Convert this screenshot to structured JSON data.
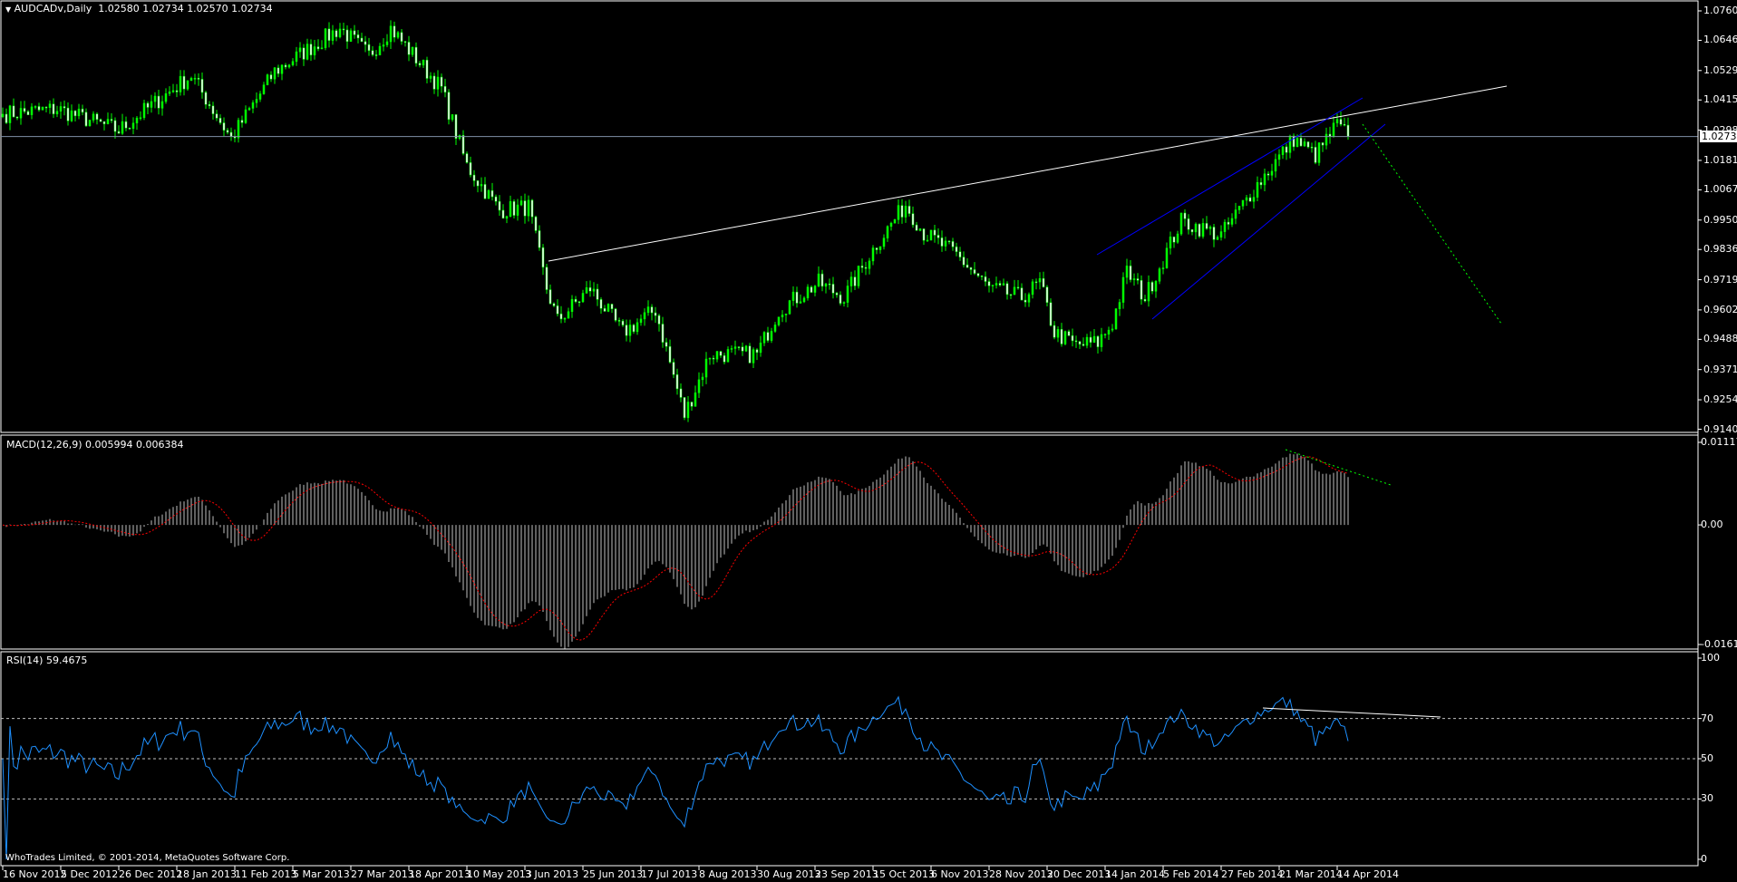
{
  "header": {
    "symbol_title": "AUDCADv,Daily",
    "ohlc": "1.02580 1.02734 1.02570 1.02734"
  },
  "macd_title": "MACD(12,26,9) 0.005994 0.006384",
  "rsi_title": "RSI(14) 59.4675",
  "copyright": "WhoTrades Limited, © 2001-2014, MetaQuotes Software Corp.",
  "colors": {
    "candle": "#00ff00",
    "macd_hist": "#c0c0c0",
    "macd_signal": "#ff0000",
    "rsi": "#1e90ff",
    "trendline": "#ffffff",
    "channel": "#0000ff",
    "projection": "#00ff00",
    "price_line": "#8090a8"
  },
  "chart_data": [
    {
      "type": "candlestick",
      "title": "AUDCADv,Daily",
      "current_price": "1.02734",
      "y_ticks": [
        "1.07600",
        "1.06460",
        "1.05290",
        "1.04150",
        "1.02980",
        "1.01810",
        "1.00670",
        "0.99500",
        "0.98360",
        "0.97190",
        "0.96020",
        "0.94880",
        "0.93710",
        "0.92540",
        "0.91400"
      ],
      "ylim": [
        0.914,
        1.076
      ],
      "x_ticks": [
        "16 Nov 2012",
        "5 Dec 2012",
        "26 Dec 2012",
        "18 Jan 2013",
        "11 Feb 2013",
        "5 Mar 2013",
        "27 Mar 2013",
        "18 Apr 2013",
        "10 May 2013",
        "3 Jun 2013",
        "25 Jun 2013",
        "17 Jul 2013",
        "8 Aug 2013",
        "30 Aug 2013",
        "23 Sep 2013",
        "15 Oct 2013",
        "6 Nov 2013",
        "28 Nov 2013",
        "20 Dec 2013",
        "14 Jan 2014",
        "5 Feb 2014",
        "27 Feb 2014",
        "21 Mar 2014",
        "14 Apr 2014"
      ],
      "bars_per_tick": 16,
      "bar_count": 372,
      "close_anchors": [
        [
          0,
          1.036
        ],
        [
          15,
          1.038
        ],
        [
          32,
          1.0297
        ],
        [
          52,
          1.051
        ],
        [
          63,
          1.0265
        ],
        [
          75,
          1.0525
        ],
        [
          93,
          1.0693
        ],
        [
          101,
          1.0588
        ],
        [
          107,
          1.0693
        ],
        [
          121,
          1.0458
        ],
        [
          128,
          1.016
        ],
        [
          137,
          0.9988
        ],
        [
          145,
          1.0
        ],
        [
          150,
          0.9686
        ],
        [
          153,
          0.956
        ],
        [
          162,
          0.9686
        ],
        [
          171,
          0.9514
        ],
        [
          180,
          0.9602
        ],
        [
          188,
          0.9194
        ],
        [
          195,
          0.943
        ],
        [
          208,
          0.943
        ],
        [
          214,
          0.9602
        ],
        [
          225,
          0.9707
        ],
        [
          232,
          0.965
        ],
        [
          241,
          0.9858
        ],
        [
          249,
          1.001
        ],
        [
          254,
          0.99
        ],
        [
          263,
          0.9816
        ],
        [
          272,
          0.9686
        ],
        [
          281,
          0.965
        ],
        [
          286,
          0.9707
        ],
        [
          290,
          0.9514
        ],
        [
          296,
          0.9465
        ],
        [
          302,
          0.9475
        ],
        [
          306,
          0.955
        ],
        [
          310,
          0.975
        ],
        [
          315,
          0.965
        ],
        [
          325,
          0.9946
        ],
        [
          336,
          0.989
        ],
        [
          345,
          1.007
        ],
        [
          356,
          1.0265
        ],
        [
          362,
          1.02
        ],
        [
          368,
          1.032
        ],
        [
          371,
          1.02734
        ]
      ]
    },
    {
      "type": "histogram+line",
      "title": "MACD(12,26,9)",
      "params": [
        12,
        26,
        9
      ],
      "last_values": [
        0.005994,
        0.006384
      ],
      "y_ticks": [
        "0.011176",
        "0.00",
        "-0.016188"
      ],
      "ylim": [
        -0.016188,
        0.011176
      ]
    },
    {
      "type": "line",
      "title": "RSI(14)",
      "period": 14,
      "last_value": 59.4675,
      "y_ticks": [
        "100",
        "70",
        "50",
        "30",
        "0"
      ],
      "levels": [
        70,
        50,
        30
      ],
      "ylim": [
        0,
        100
      ]
    }
  ]
}
